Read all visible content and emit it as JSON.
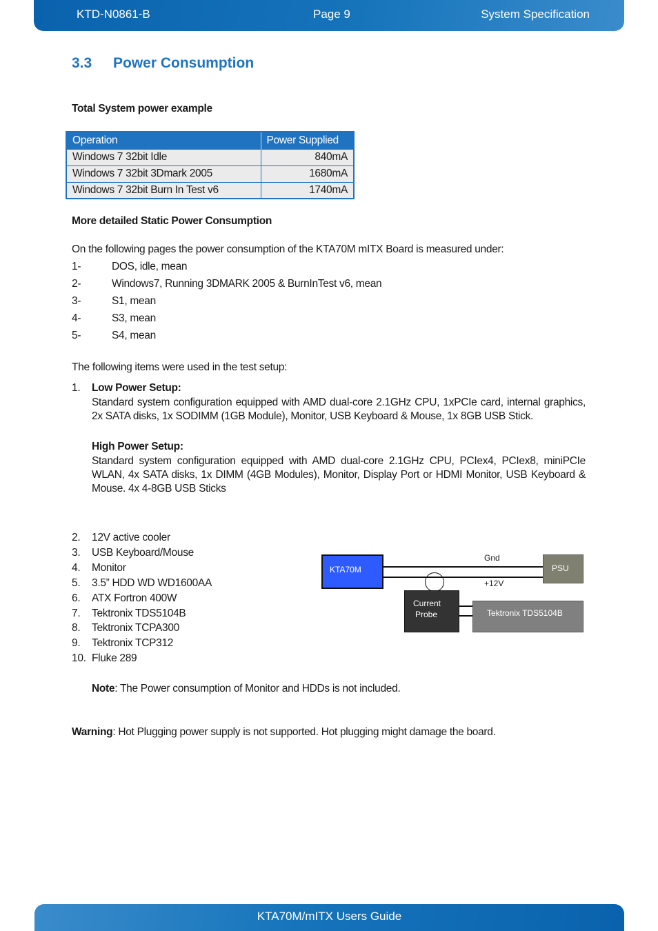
{
  "header": {
    "doc_id": "KTD-N0861-B",
    "page": "Page 9",
    "section": "System Specification"
  },
  "footer": {
    "title": "KTA70M/mITX Users Guide"
  },
  "section": {
    "number": "3.3",
    "title": "Power Consumption"
  },
  "total_power": {
    "heading": "Total System power example",
    "columns": [
      "Operation",
      "Power Supplied"
    ],
    "rows": [
      {
        "operation": "Windows 7 32bit Idle",
        "power": "840mA"
      },
      {
        "operation": "Windows 7 32bit 3Dmark 2005",
        "power": "1680mA"
      },
      {
        "operation": "Windows 7 32bit Burn In Test v6",
        "power": "1740mA"
      }
    ]
  },
  "static": {
    "heading": "More detailed Static Power Consumption",
    "intro": "On the following pages the power consumption of the KTA70M mITX Board is measured under:",
    "conditions": [
      {
        "n": "1-",
        "text": "DOS, idle, mean"
      },
      {
        "n": "2-",
        "text": "Windows7, Running 3DMARK 2005 & BurnInTest v6, mean"
      },
      {
        "n": "3-",
        "text": "S1, mean"
      },
      {
        "n": "4-",
        "text": "S3, mean"
      },
      {
        "n": "5-",
        "text": "S4, mean"
      }
    ],
    "setup_intro": "The following items were used in the test setup:"
  },
  "setup": {
    "item1_n": "1.",
    "low_title": "Low Power Setup:",
    "low_text": "Standard system configuration equipped with AMD dual-core 2.1GHz CPU, 1xPCIe card, internal graphics, 2x SATA disks, 1x SODIMM (1GB Module),  Monitor, USB Keyboard & Mouse, 1x 8GB USB Stick.",
    "high_title": "High Power Setup:",
    "high_text": "Standard system configuration equipped with AMD dual-core 2.1GHz CPU, PCIex4, PCIex8, miniPCIe WLAN, 4x SATA disks, 1x DIMM (4GB Modules), Monitor, Display Port or HDMI Monitor, USB Keyboard & Mouse. 4x 4-8GB USB Sticks",
    "items": [
      {
        "n": "2.",
        "text": "12V active cooler"
      },
      {
        "n": "3.",
        "text": "USB Keyboard/Mouse"
      },
      {
        "n": "4.",
        "text": "Monitor"
      },
      {
        "n": "5.",
        "text": "3.5” HDD WD WD1600AA"
      },
      {
        "n": "6.",
        "text": "ATX Fortron 400W"
      },
      {
        "n": "7.",
        "text": "Tektronix TDS5104B"
      },
      {
        "n": "8.",
        "text": "Tektronix TCPA300"
      },
      {
        "n": "9.",
        "text": "Tektronix TCP312"
      },
      {
        "n": "10.",
        "text": "Fluke 289"
      }
    ],
    "note_label": "Note",
    "note_text": ":  The Power consumption of Monitor and HDDs is not included."
  },
  "warning": {
    "label": "Warning",
    "text": ": Hot Plugging power supply is not supported. Hot plugging might damage the board."
  },
  "diagram": {
    "board": "KTA70M",
    "psu": "PSU",
    "gnd": "Gnd",
    "v12": "+12V",
    "probe_line1": "Current",
    "probe_line2": "Probe",
    "scope": "Tektronix TDS5104B",
    "colors": {
      "board": "#2e5bff",
      "psu": "#808070",
      "probe": "#333333",
      "scope": "#808080"
    }
  }
}
